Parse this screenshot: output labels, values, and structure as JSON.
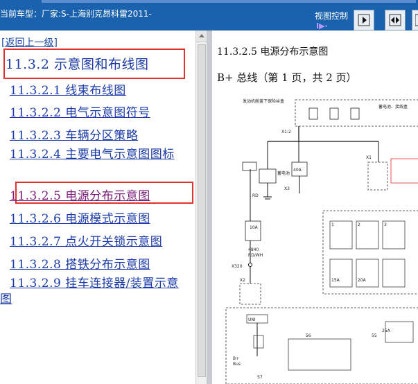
{
  "header": {
    "car_label": "当前车型：厂家:S-上海别克昂科雷2011-",
    "view_label": "视图控制",
    "view_glyph": "I▶·",
    "buttons": [
      {
        "icon": "arrow-right-icon"
      },
      {
        "icon": "split-view-icon"
      },
      {
        "icon": "panel-icon"
      }
    ]
  },
  "sidebar": {
    "back_link": "[返回上一级]",
    "main_item": "11.3.2 示意图和布线图",
    "items": [
      "11.3.2.1 线束布线图",
      "11.3.2.2 电气示意图符号",
      "11.3.2.3 车辆分区策略",
      "11.3.2.4 主要电气示意图图标",
      "11.3.2.5 电源分布示意图",
      "11.3.2.6 电源模式示意图",
      "11.3.2.7 点火开关锁示意图",
      "11.3.2.8 搭铁分布示意图",
      "11.3.2.9 挂车连接器/装置示意图"
    ],
    "selected_index": 4
  },
  "document": {
    "title": "11.3.2.5 电源分布示意图",
    "subtitle": "B+ 总线（第 1 页，共 2 页）",
    "diagram_labels": {
      "top_left_note": "发动机舱盖下保险丝盒",
      "top_right_note": "蓄电池、接线盒",
      "battery": "蓄电池",
      "fuse_40a": "40A",
      "fuse_10a": "10A",
      "wire_4840": "4840",
      "wire_red": "RD/WH",
      "ground_x1": "X1",
      "ground_x2": "X2",
      "ground_x3": "X3",
      "splice": "X320",
      "fuse_b1": "15A",
      "fuse_b2": "20A",
      "b_plus": "B+",
      "bus": "Bus",
      "fuse_25a": "25A",
      "num_55": "55",
      "num_56": "56",
      "num_57": "57",
      "num_1": "1",
      "num_2": "2",
      "num_3": "3",
      "rd": "RD",
      "uni": "UNI",
      "grid_label": "X1:2"
    }
  }
}
